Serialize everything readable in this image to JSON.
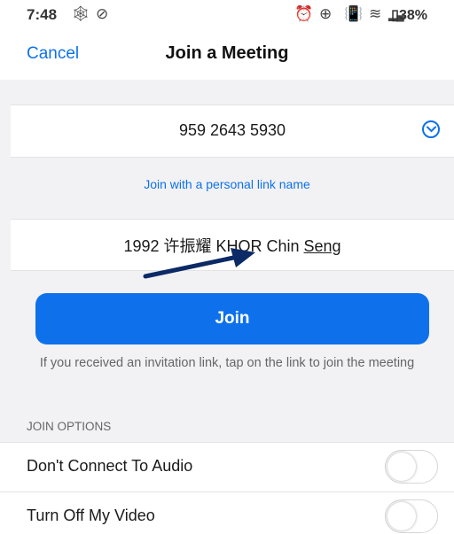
{
  "status_bar": {
    "time": "7:48",
    "battery": "38%",
    "icons": [
      "notification-icon",
      "check-icon",
      "alarm-icon",
      "sync-icon",
      "vibrate-icon",
      "wifi-icon",
      "signal-icon",
      "battery-icon"
    ]
  },
  "nav": {
    "cancel_label": "Cancel",
    "title": "Join a Meeting"
  },
  "meeting_id": "959 2643 5930",
  "personal_link_label": "Join with a personal link name",
  "display_name": {
    "prefix": "1992 许振耀 KHOR Chin ",
    "underlined": "Seng"
  },
  "join_button_label": "Join",
  "hint_text": "If you received an invitation link, tap on the link to join the meeting",
  "join_options": {
    "header": "JOIN OPTIONS",
    "items": [
      {
        "label": "Don't Connect To Audio",
        "enabled": false
      },
      {
        "label": "Turn Off My Video",
        "enabled": false
      }
    ]
  },
  "colors": {
    "accent": "#0e71eb",
    "background": "#f2f2f4",
    "annotation_arrow": "#0b2a66"
  }
}
